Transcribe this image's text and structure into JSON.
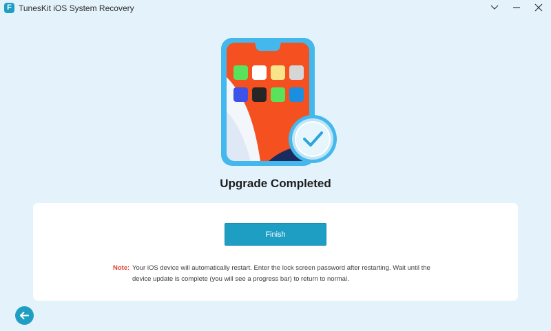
{
  "window": {
    "title": "TunesKit iOS System Recovery",
    "logo_glyph": "F"
  },
  "icons": {
    "app_logo": "tuneskit-logo-icon",
    "collapse": "chevron-down-icon",
    "minimize": "minimize-icon",
    "close": "close-icon",
    "back": "arrow-left-icon",
    "success": "check-circle-icon",
    "device": "iphone-icon"
  },
  "main": {
    "heading": "Upgrade Completed",
    "finish_label": "Finish",
    "note_label": "Note:",
    "note_text": "Your iOS device will automatically restart. Enter the lock screen password after restarting. Wait until the device update is complete (you will see a progress bar) to return to normal."
  },
  "colors": {
    "accent": "#1f9ec4",
    "background": "#e4f3fb",
    "note_label": "#e23d2f"
  }
}
